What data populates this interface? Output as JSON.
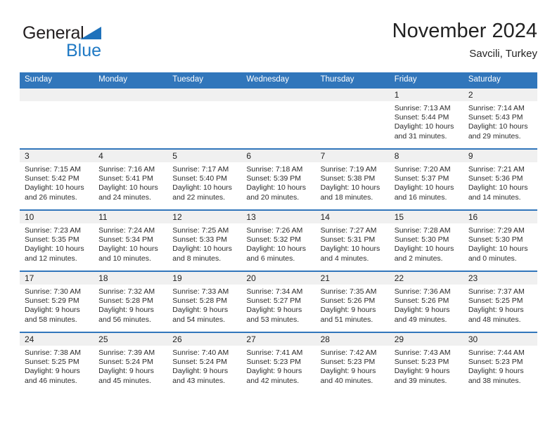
{
  "brand": {
    "word_one": "General",
    "word_two": "Blue",
    "triangle_color": "#1f72bb",
    "blue_text_color": "#1f79c4"
  },
  "header": {
    "title": "November 2024",
    "subtitle": "Savcili, Turkey"
  },
  "theme": {
    "header_blue": "#3176bb",
    "day_band_gray": "#f0f0f0"
  },
  "weekdays": [
    "Sunday",
    "Monday",
    "Tuesday",
    "Wednesday",
    "Thursday",
    "Friday",
    "Saturday"
  ],
  "weeks": [
    [
      {
        "empty": true
      },
      {
        "empty": true
      },
      {
        "empty": true
      },
      {
        "empty": true
      },
      {
        "empty": true
      },
      {
        "day": "1",
        "sunrise": "Sunrise: 7:13 AM",
        "sunset": "Sunset: 5:44 PM",
        "daylight": "Daylight: 10 hours and 31 minutes."
      },
      {
        "day": "2",
        "sunrise": "Sunrise: 7:14 AM",
        "sunset": "Sunset: 5:43 PM",
        "daylight": "Daylight: 10 hours and 29 minutes."
      }
    ],
    [
      {
        "day": "3",
        "sunrise": "Sunrise: 7:15 AM",
        "sunset": "Sunset: 5:42 PM",
        "daylight": "Daylight: 10 hours and 26 minutes."
      },
      {
        "day": "4",
        "sunrise": "Sunrise: 7:16 AM",
        "sunset": "Sunset: 5:41 PM",
        "daylight": "Daylight: 10 hours and 24 minutes."
      },
      {
        "day": "5",
        "sunrise": "Sunrise: 7:17 AM",
        "sunset": "Sunset: 5:40 PM",
        "daylight": "Daylight: 10 hours and 22 minutes."
      },
      {
        "day": "6",
        "sunrise": "Sunrise: 7:18 AM",
        "sunset": "Sunset: 5:39 PM",
        "daylight": "Daylight: 10 hours and 20 minutes."
      },
      {
        "day": "7",
        "sunrise": "Sunrise: 7:19 AM",
        "sunset": "Sunset: 5:38 PM",
        "daylight": "Daylight: 10 hours and 18 minutes."
      },
      {
        "day": "8",
        "sunrise": "Sunrise: 7:20 AM",
        "sunset": "Sunset: 5:37 PM",
        "daylight": "Daylight: 10 hours and 16 minutes."
      },
      {
        "day": "9",
        "sunrise": "Sunrise: 7:21 AM",
        "sunset": "Sunset: 5:36 PM",
        "daylight": "Daylight: 10 hours and 14 minutes."
      }
    ],
    [
      {
        "day": "10",
        "sunrise": "Sunrise: 7:23 AM",
        "sunset": "Sunset: 5:35 PM",
        "daylight": "Daylight: 10 hours and 12 minutes."
      },
      {
        "day": "11",
        "sunrise": "Sunrise: 7:24 AM",
        "sunset": "Sunset: 5:34 PM",
        "daylight": "Daylight: 10 hours and 10 minutes."
      },
      {
        "day": "12",
        "sunrise": "Sunrise: 7:25 AM",
        "sunset": "Sunset: 5:33 PM",
        "daylight": "Daylight: 10 hours and 8 minutes."
      },
      {
        "day": "13",
        "sunrise": "Sunrise: 7:26 AM",
        "sunset": "Sunset: 5:32 PM",
        "daylight": "Daylight: 10 hours and 6 minutes."
      },
      {
        "day": "14",
        "sunrise": "Sunrise: 7:27 AM",
        "sunset": "Sunset: 5:31 PM",
        "daylight": "Daylight: 10 hours and 4 minutes."
      },
      {
        "day": "15",
        "sunrise": "Sunrise: 7:28 AM",
        "sunset": "Sunset: 5:30 PM",
        "daylight": "Daylight: 10 hours and 2 minutes."
      },
      {
        "day": "16",
        "sunrise": "Sunrise: 7:29 AM",
        "sunset": "Sunset: 5:30 PM",
        "daylight": "Daylight: 10 hours and 0 minutes."
      }
    ],
    [
      {
        "day": "17",
        "sunrise": "Sunrise: 7:30 AM",
        "sunset": "Sunset: 5:29 PM",
        "daylight": "Daylight: 9 hours and 58 minutes."
      },
      {
        "day": "18",
        "sunrise": "Sunrise: 7:32 AM",
        "sunset": "Sunset: 5:28 PM",
        "daylight": "Daylight: 9 hours and 56 minutes."
      },
      {
        "day": "19",
        "sunrise": "Sunrise: 7:33 AM",
        "sunset": "Sunset: 5:28 PM",
        "daylight": "Daylight: 9 hours and 54 minutes."
      },
      {
        "day": "20",
        "sunrise": "Sunrise: 7:34 AM",
        "sunset": "Sunset: 5:27 PM",
        "daylight": "Daylight: 9 hours and 53 minutes."
      },
      {
        "day": "21",
        "sunrise": "Sunrise: 7:35 AM",
        "sunset": "Sunset: 5:26 PM",
        "daylight": "Daylight: 9 hours and 51 minutes."
      },
      {
        "day": "22",
        "sunrise": "Sunrise: 7:36 AM",
        "sunset": "Sunset: 5:26 PM",
        "daylight": "Daylight: 9 hours and 49 minutes."
      },
      {
        "day": "23",
        "sunrise": "Sunrise: 7:37 AM",
        "sunset": "Sunset: 5:25 PM",
        "daylight": "Daylight: 9 hours and 48 minutes."
      }
    ],
    [
      {
        "day": "24",
        "sunrise": "Sunrise: 7:38 AM",
        "sunset": "Sunset: 5:25 PM",
        "daylight": "Daylight: 9 hours and 46 minutes."
      },
      {
        "day": "25",
        "sunrise": "Sunrise: 7:39 AM",
        "sunset": "Sunset: 5:24 PM",
        "daylight": "Daylight: 9 hours and 45 minutes."
      },
      {
        "day": "26",
        "sunrise": "Sunrise: 7:40 AM",
        "sunset": "Sunset: 5:24 PM",
        "daylight": "Daylight: 9 hours and 43 minutes."
      },
      {
        "day": "27",
        "sunrise": "Sunrise: 7:41 AM",
        "sunset": "Sunset: 5:23 PM",
        "daylight": "Daylight: 9 hours and 42 minutes."
      },
      {
        "day": "28",
        "sunrise": "Sunrise: 7:42 AM",
        "sunset": "Sunset: 5:23 PM",
        "daylight": "Daylight: 9 hours and 40 minutes."
      },
      {
        "day": "29",
        "sunrise": "Sunrise: 7:43 AM",
        "sunset": "Sunset: 5:23 PM",
        "daylight": "Daylight: 9 hours and 39 minutes."
      },
      {
        "day": "30",
        "sunrise": "Sunrise: 7:44 AM",
        "sunset": "Sunset: 5:23 PM",
        "daylight": "Daylight: 9 hours and 38 minutes."
      }
    ]
  ]
}
